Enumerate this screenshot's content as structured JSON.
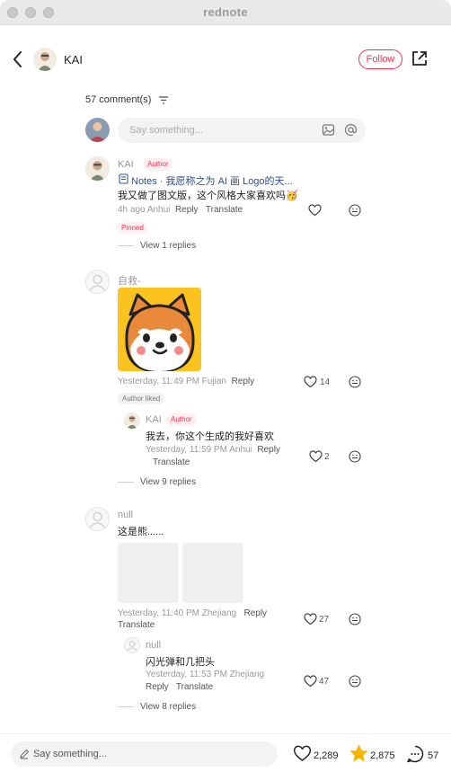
{
  "window": {
    "title": "rednote"
  },
  "header": {
    "author_name": "KAI",
    "follow_label": "Follow"
  },
  "comments_header": {
    "count_label": "57 comment(s)"
  },
  "input": {
    "placeholder": "Say something..."
  },
  "comments": [
    {
      "name": "KAI",
      "badge": "Author",
      "note_link": "Notes · 我愿称之为 AI 画 Logo的天...",
      "text": "我又做了图文版，这个风格大家喜欢吗🥳",
      "meta": "4h ago Anhui",
      "reply": "Reply",
      "translate": "Translate",
      "pinned": "Pinned",
      "view_replies": "View 1 replies"
    },
    {
      "name": "自救-",
      "meta": "Yesterday, 11:49 PM Fujian",
      "reply": "Reply",
      "likes": "14",
      "author_liked": "Author liked",
      "sub": {
        "name": "KAI",
        "badge": "Author",
        "text": "我去，你这个生成的我好喜欢",
        "meta": "Yesterday, 11:59 PM Anhui",
        "reply": "Reply",
        "translate": "Translate",
        "likes": "2"
      },
      "view_replies": "View 9 replies"
    },
    {
      "name": "null",
      "text": "这是熊......",
      "meta": "Yesterday, 11:40 PM Zhejiang",
      "reply": "Reply",
      "translate": "Translate",
      "likes": "27",
      "sub": {
        "name": "null",
        "text": "闪光弹和几把头",
        "meta": "Yesterday, 11:53 PM Zhejiang",
        "reply": "Reply",
        "translate": "Translate",
        "likes": "47"
      },
      "view_replies": "View 8 replies"
    }
  ],
  "bottom": {
    "placeholder": "Say something...",
    "likes": "2,289",
    "stars": "2,875",
    "comments": "57"
  },
  "colors": {
    "accent": "#ff2e4d",
    "star": "#f7b500",
    "doge_bg": "#fcc31e"
  }
}
